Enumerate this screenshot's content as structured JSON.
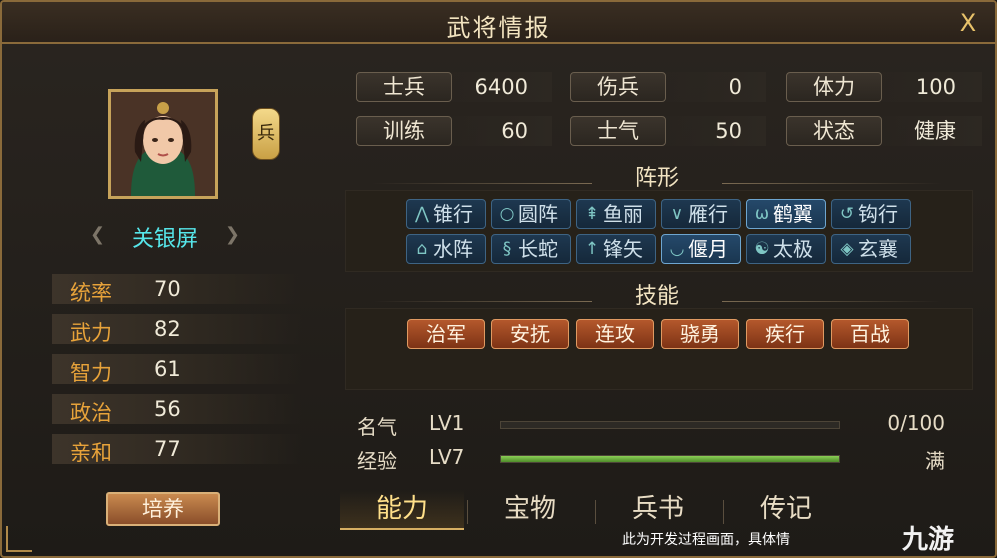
{
  "window": {
    "title": "武将情报",
    "close_label": "X"
  },
  "hero": {
    "name": "关银屏",
    "troop_badge": "兵",
    "stats": [
      {
        "label": "统率",
        "value": "70"
      },
      {
        "label": "武力",
        "value": "82"
      },
      {
        "label": "智力",
        "value": "61"
      },
      {
        "label": "政治",
        "value": "56"
      },
      {
        "label": "亲和",
        "value": "77"
      }
    ],
    "cultivate_label": "培养"
  },
  "army": {
    "soldiers": {
      "label": "士兵",
      "value": "6400"
    },
    "wounded": {
      "label": "伤兵",
      "value": "0"
    },
    "stamina": {
      "label": "体力",
      "value": "100"
    },
    "training": {
      "label": "训练",
      "value": "60"
    },
    "morale": {
      "label": "士气",
      "value": "50"
    },
    "status": {
      "label": "状态",
      "value": "健康"
    }
  },
  "formation": {
    "title": "阵形",
    "items": [
      {
        "label": "锥行",
        "icon": "arrow-up-icon"
      },
      {
        "label": "圆阵",
        "icon": "circle-icon"
      },
      {
        "label": "鱼丽",
        "icon": "fish-icon"
      },
      {
        "label": "雁行",
        "icon": "v-icon"
      },
      {
        "label": "鹤翼",
        "icon": "wing-icon",
        "active": true
      },
      {
        "label": "钩行",
        "icon": "hook-icon"
      },
      {
        "label": "水阵",
        "icon": "house-icon"
      },
      {
        "label": "长蛇",
        "icon": "snake-icon"
      },
      {
        "label": "锋矢",
        "icon": "arrow-icon"
      },
      {
        "label": "偃月",
        "icon": "moon-icon",
        "active": true
      },
      {
        "label": "太极",
        "icon": "taiji-icon"
      },
      {
        "label": "玄襄",
        "icon": "diamond-icon"
      }
    ]
  },
  "skills": {
    "title": "技能",
    "items": [
      "治军",
      "安抚",
      "连攻",
      "骁勇",
      "疾行",
      "百战"
    ]
  },
  "progress": {
    "fame": {
      "label": "名气",
      "level": "LV1",
      "value": "0/100",
      "fraction": 0.0
    },
    "exp": {
      "label": "经验",
      "level": "LV7",
      "value": "满",
      "fraction": 1.0
    }
  },
  "tabs": [
    "能力",
    "宝物",
    "兵书",
    "传记"
  ],
  "footer": {
    "note": "此为开发过程画面，具体情",
    "watermark": "九游"
  },
  "colors": {
    "accent_gold": "#e8a33a",
    "name_cyan": "#56e6ea",
    "formation_blue": "#1e3850",
    "skill_orange": "#b4582c",
    "exp_green": "#6fb040"
  }
}
